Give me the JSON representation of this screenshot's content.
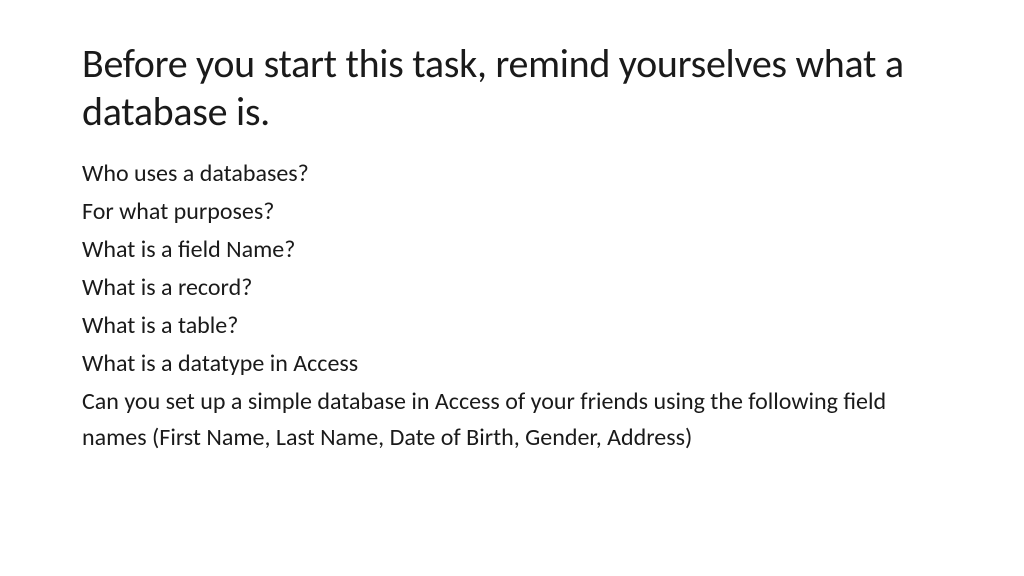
{
  "slide": {
    "title": "Before you start this task, remind yourselves what a database is.",
    "lines": [
      "Who uses a databases?",
      "For what purposes?",
      "What is a field Name?",
      "What is a record?",
      "What is a table?",
      "What is a datatype in Access",
      "Can you set up a simple database in Access of your friends using the following field names (First Name, Last Name, Date of Birth, Gender, Address)"
    ]
  }
}
